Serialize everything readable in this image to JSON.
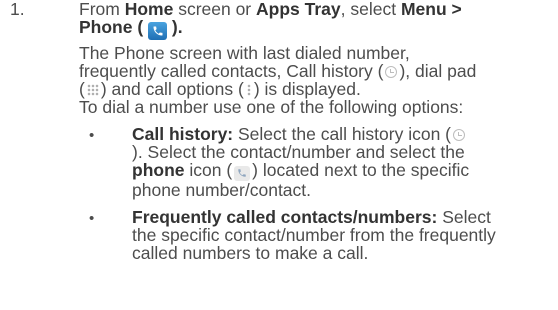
{
  "step": {
    "number": "1.",
    "l1_pre": "From ",
    "l1_home": "Home",
    "l1_mid": " screen or ",
    "l1_apps": "Apps Tray",
    "l1_post": ", select ",
    "l1_menu": "Menu >",
    "l2_phone": "Phone (",
    "l2_close": ").",
    "p1": "The Phone screen with last dialed number,",
    "p2_pre": "frequently called contacts, Call history (",
    "p2_post": "), dial pad",
    "p3_open": "(",
    "p3_mid": ") and call options (",
    "p3_post": ") is displayed.",
    "p4": "To dial a number use one of the following options:"
  },
  "bullets": [
    {
      "symbol": "•",
      "b1_title": "Call history:",
      "b1_text": " Select the call history icon (",
      "b1_l2": "). Select the contact/number and select the",
      "b1_l3_bold": "phone",
      "b1_l3_pre": " icon (",
      "b1_l3_post": ") located next to the specific",
      "b1_l4": "phone number/contact."
    },
    {
      "symbol": "•",
      "b2_title": "Frequently called contacts/numbers:",
      "b2_text": " Select",
      "b2_l2": "the specific contact/number from the frequently",
      "b2_l3": "called numbers to make a call."
    }
  ],
  "icons": {
    "phone_app": "phone-app-icon",
    "call_history": "clock-icon",
    "dial_pad": "dial-pad-icon",
    "call_options": "vertical-dots-icon",
    "phone": "phone-icon"
  },
  "colors": {
    "text": "#4d4d4d",
    "bold": "#333333",
    "phone_app_icon": "#1f6fb4"
  }
}
